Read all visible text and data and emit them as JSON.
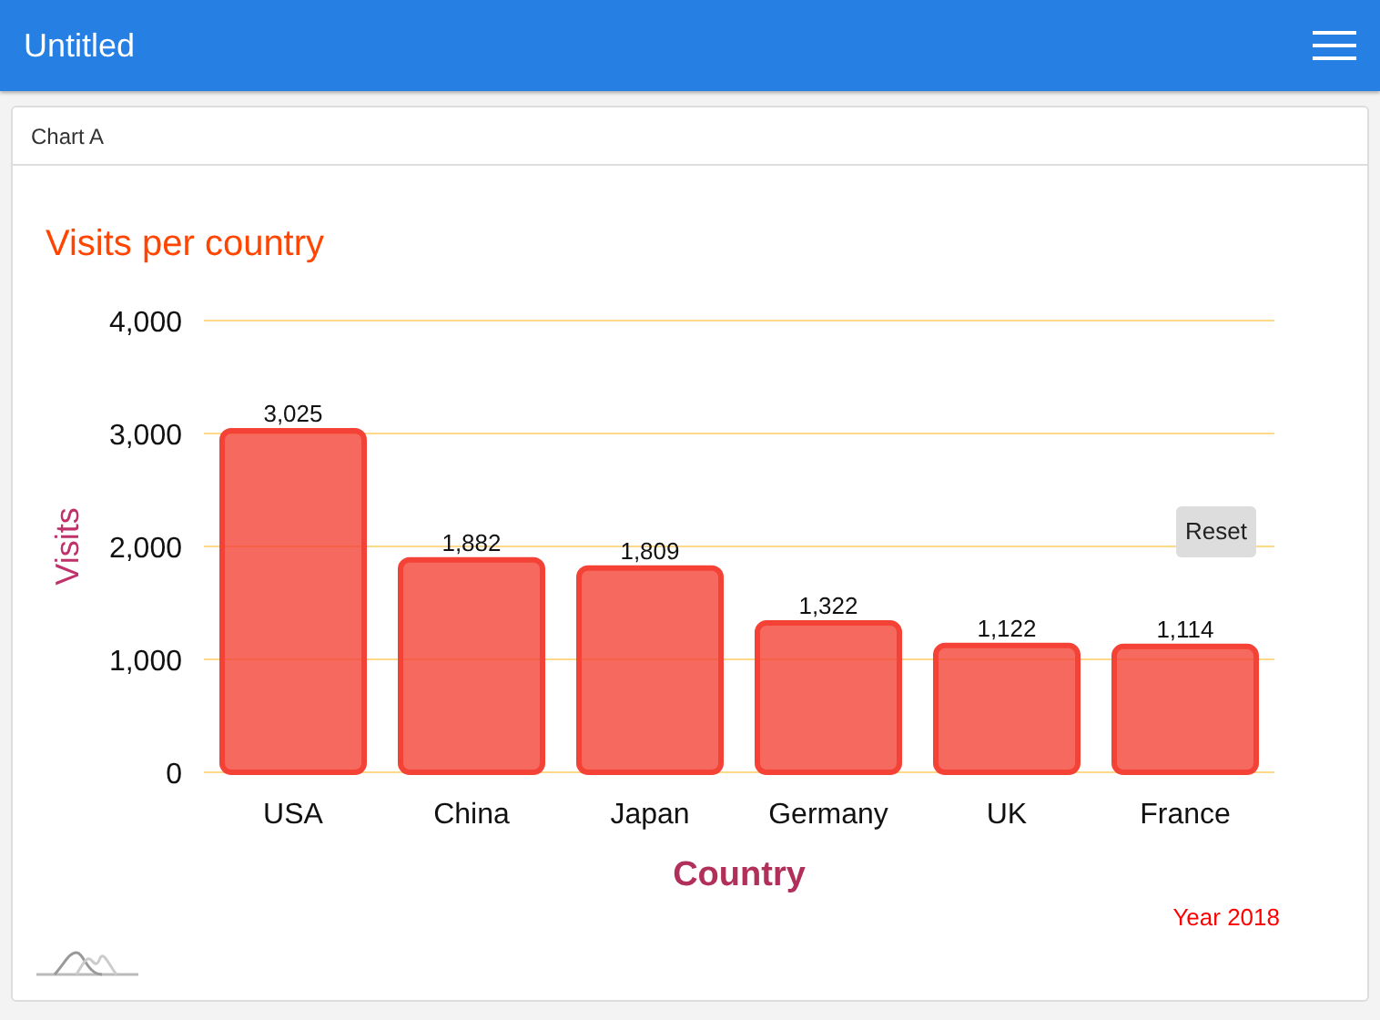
{
  "app_bar": {
    "title": "Untitled"
  },
  "card": {
    "tab": "Chart A",
    "reset_button": "Reset",
    "caption": "Year 2018",
    "chart_data": {
      "type": "bar",
      "title": "Visits per country",
      "xlabel": "Country",
      "ylabel": "Visits",
      "categories": [
        "USA",
        "China",
        "Japan",
        "Germany",
        "UK",
        "France"
      ],
      "series": [
        {
          "color": "#f44336",
          "values": [
            3025,
            1882,
            1809,
            1322,
            1122,
            1114
          ]
        }
      ],
      "ylim": [
        0,
        4000
      ],
      "yticks": [
        {
          "value": 0,
          "label": "0"
        },
        {
          "value": 1000,
          "label": "1,000"
        },
        {
          "value": 2000,
          "label": "2,000"
        },
        {
          "value": 3000,
          "label": "3,000"
        },
        {
          "value": 4000,
          "label": "4,000"
        }
      ],
      "grid": true,
      "value_labels": [
        "3,025",
        "1,882",
        "1,809",
        "1,322",
        "1,122",
        "1,114"
      ]
    }
  }
}
